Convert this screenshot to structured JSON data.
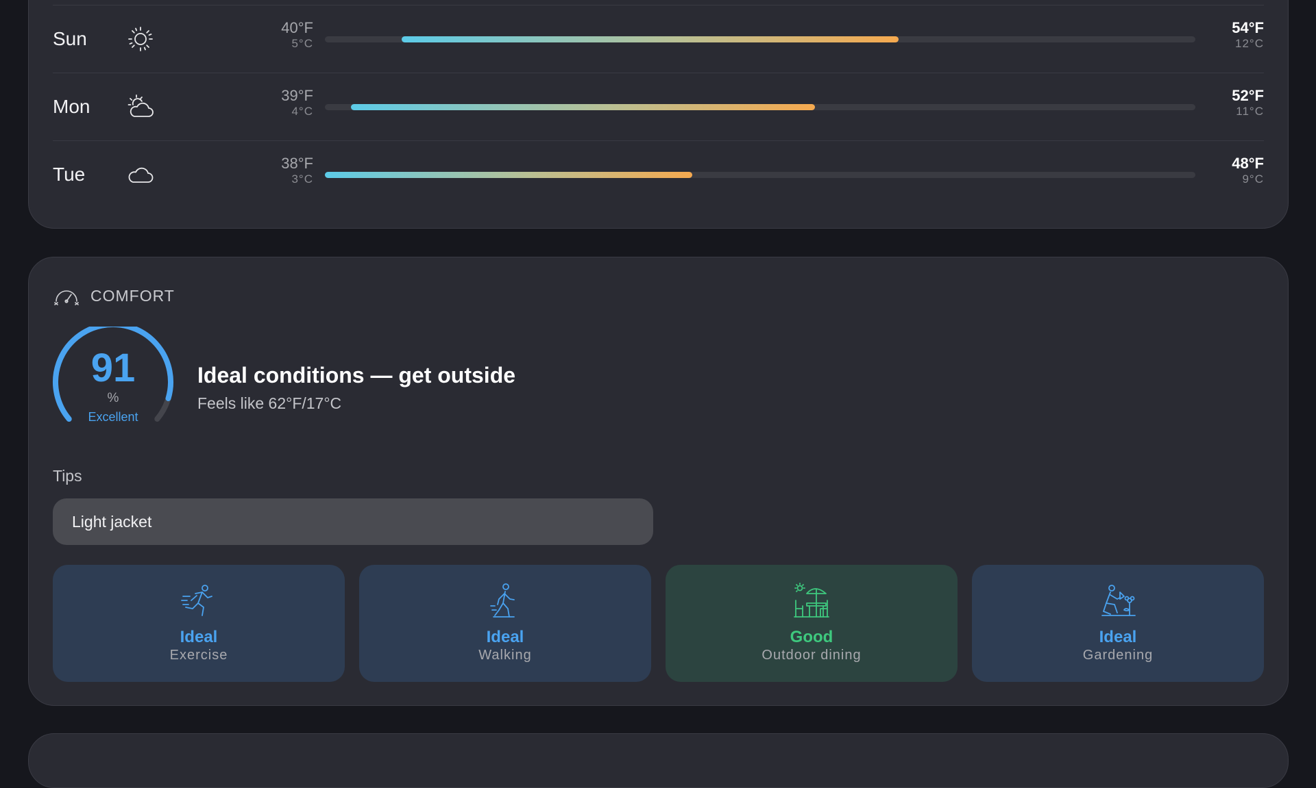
{
  "forecast": [
    {
      "day": "Sun",
      "icon": "sun-icon",
      "low_f": "40°F",
      "low_c": "5°C",
      "high_f": "54°F",
      "high_c": "12°C",
      "range_start": 0.088,
      "range_end": 0.659
    },
    {
      "day": "Mon",
      "icon": "partly-cloudy-icon",
      "low_f": "39°F",
      "low_c": "4°C",
      "high_f": "52°F",
      "high_c": "11°C",
      "range_start": 0.03,
      "range_end": 0.563
    },
    {
      "day": "Tue",
      "icon": "cloud-icon",
      "low_f": "38°F",
      "low_c": "3°C",
      "high_f": "48°F",
      "high_c": "9°C",
      "range_start": 0.0,
      "range_end": 0.422
    }
  ],
  "comfort": {
    "title": "COMFORT",
    "score": "91",
    "score_fraction": 0.91,
    "unit": "%",
    "rating": "Excellent",
    "headline": "Ideal conditions — get outside",
    "feels_like": "Feels like 62°F/17°C",
    "tips_label": "Tips",
    "tips": [
      "Light jacket"
    ],
    "activities": [
      {
        "rating": "Ideal",
        "name": "Exercise",
        "icon": "running-icon",
        "tone": "blue"
      },
      {
        "rating": "Ideal",
        "name": "Walking",
        "icon": "walking-icon",
        "tone": "blue"
      },
      {
        "rating": "Good",
        "name": "Outdoor dining",
        "icon": "outdoor-dining-icon",
        "tone": "green"
      },
      {
        "rating": "Ideal",
        "name": "Gardening",
        "icon": "gardening-icon",
        "tone": "blue"
      }
    ]
  },
  "colors": {
    "accent_blue": "#4aa3f0",
    "good_green": "#3ec97e",
    "range_cold": "#5ccbe8",
    "range_warm": "#f5a94f"
  }
}
